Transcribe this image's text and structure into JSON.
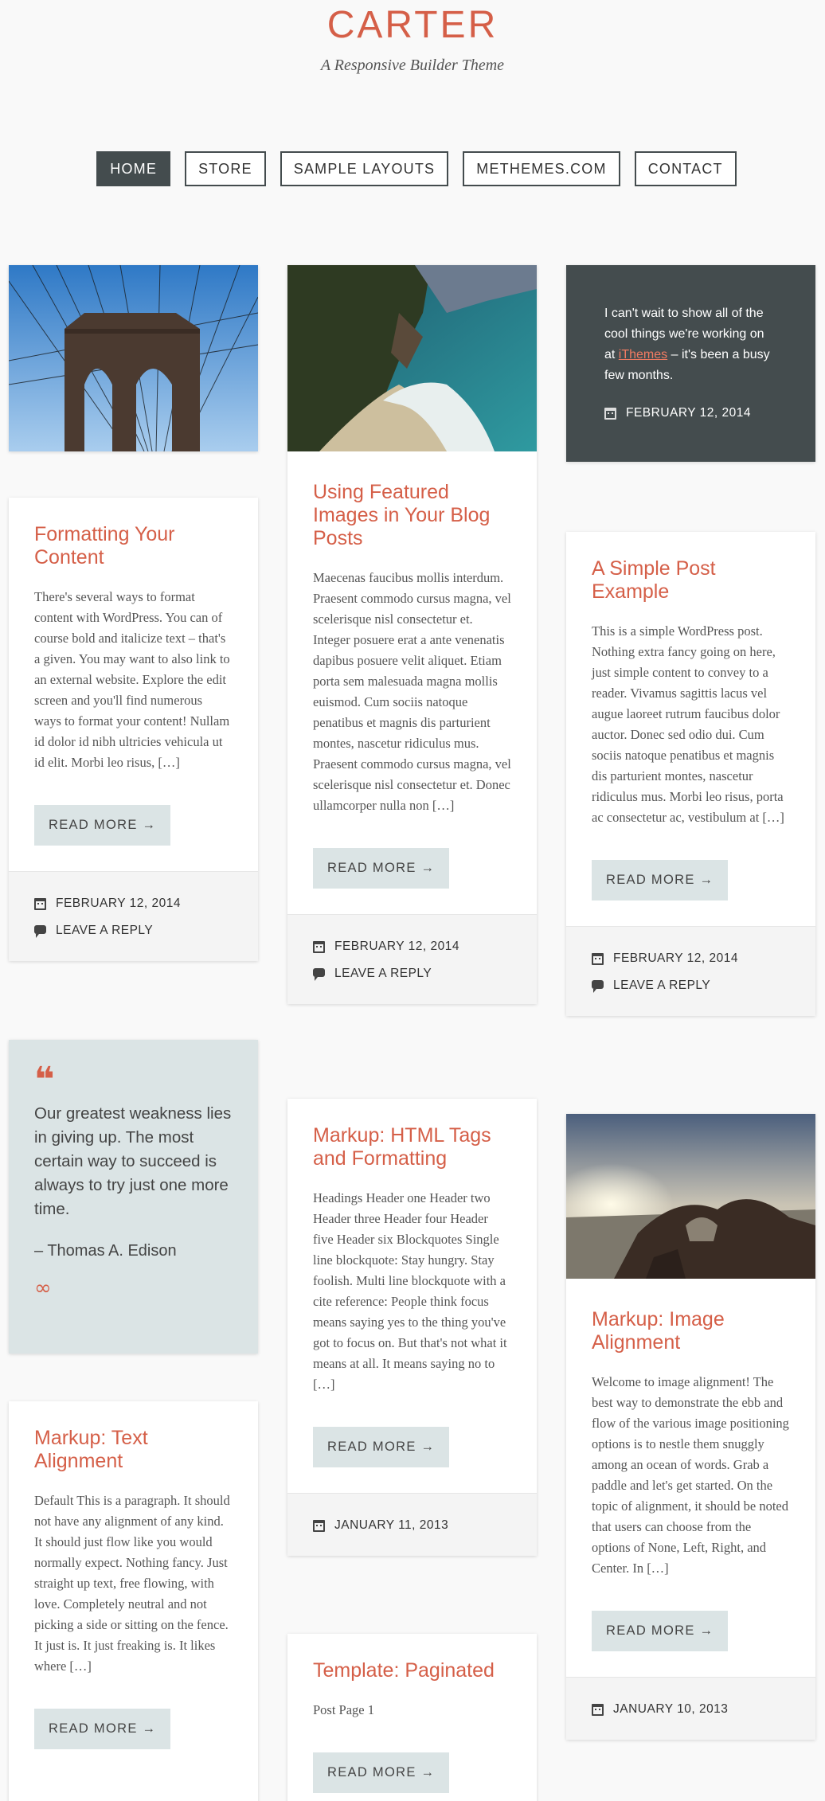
{
  "site": {
    "title": "CARTER",
    "tagline": "A Responsive Builder Theme"
  },
  "nav": {
    "items": [
      "HOME",
      "STORE",
      "SAMPLE LAYOUTS",
      "METHEMES.COM",
      "CONTACT"
    ],
    "active": "HOME"
  },
  "read_more": "READ MORE →",
  "colors": {
    "accent": "#d55f48",
    "dark": "#444c4e",
    "button": "#dbe4e5",
    "meta_bg": "#f4f4f4"
  },
  "posts": {
    "formatting": {
      "title": "Formatting Your Content",
      "excerpt": "There's several ways to format content with WordPress. You can of course bold and italicize text – that's a given. You may want to also link to an external website. Explore the edit screen and you'll find numerous ways to format your content! Nullam id dolor id nibh ultricies vehicula ut id elit. Morbi leo risus, […]",
      "date": "FEBRUARY 12, 2014",
      "comments": "LEAVE A REPLY"
    },
    "featured": {
      "title": "Using Featured Images in Your Blog Posts",
      "excerpt": "Maecenas faucibus mollis interdum. Praesent commodo cursus magna, vel scelerisque nisl consectetur et. Integer posuere erat a ante venenatis dapibus posuere velit aliquet. Etiam porta sem malesuada magna mollis euismod. Cum sociis natoque penatibus et magnis dis parturient montes, nascetur ridiculus mus. Praesent commodo cursus magna, vel scelerisque nisl consectetur et. Donec ullamcorper nulla non […]",
      "date": "FEBRUARY 12, 2014",
      "comments": "LEAVE A REPLY"
    },
    "aside": {
      "text_before": "I can't wait to show all of the cool things we're working on at ",
      "link": "iThemes",
      "text_after": " – it's been a busy few months.",
      "date": "FEBRUARY 12, 2014"
    },
    "simple": {
      "title": "A Simple Post Example",
      "excerpt": "This is a simple WordPress post. Nothing extra fancy going on here, just simple content to convey to a reader. Vivamus sagittis lacus vel augue laoreet rutrum faucibus dolor auctor. Donec sed odio dui. Cum sociis natoque penatibus et magnis dis parturient montes, nascetur ridiculus mus. Morbi leo risus, porta ac consectetur ac, vestibulum at […]",
      "date": "FEBRUARY 12, 2014",
      "comments": "LEAVE A REPLY"
    },
    "quote": {
      "text": "Our greatest weakness lies in giving up. The most certain way to succeed is always to try just one more time.",
      "cite": "– Thomas A. Edison"
    },
    "html_tags": {
      "title": "Markup: HTML Tags and Formatting",
      "excerpt": "Headings Header one Header two Header three Header four Header five Header six Blockquotes Single line blockquote: Stay hungry. Stay foolish. Multi line blockquote with a cite reference: People think focus means saying yes to the thing you've got to focus on. But that's not what it means at all. It means saying no to […]",
      "date": "JANUARY 11, 2013"
    },
    "image_alignment": {
      "title": "Markup: Image Alignment",
      "excerpt": "Welcome to image alignment! The best way to demonstrate the ebb and flow of the various image positioning options is to nestle them snuggly among an ocean of words. Grab a paddle and let's get started. On the topic of alignment, it should be noted that users can choose from the options of None, Left, Right, and Center. In […]",
      "date": "JANUARY 10, 2013"
    },
    "text_alignment": {
      "title": "Markup: Text Alignment",
      "excerpt": "Default This is a paragraph. It should not have any alignment of any kind. It should just flow like you would normally expect. Nothing fancy. Just straight up text, free flowing, with love. Completely neutral and not picking a side or sitting on the fence. It just is. It just freaking is. It likes where […]"
    },
    "paginated": {
      "title": "Template: Paginated",
      "excerpt": "Post Page 1"
    }
  }
}
